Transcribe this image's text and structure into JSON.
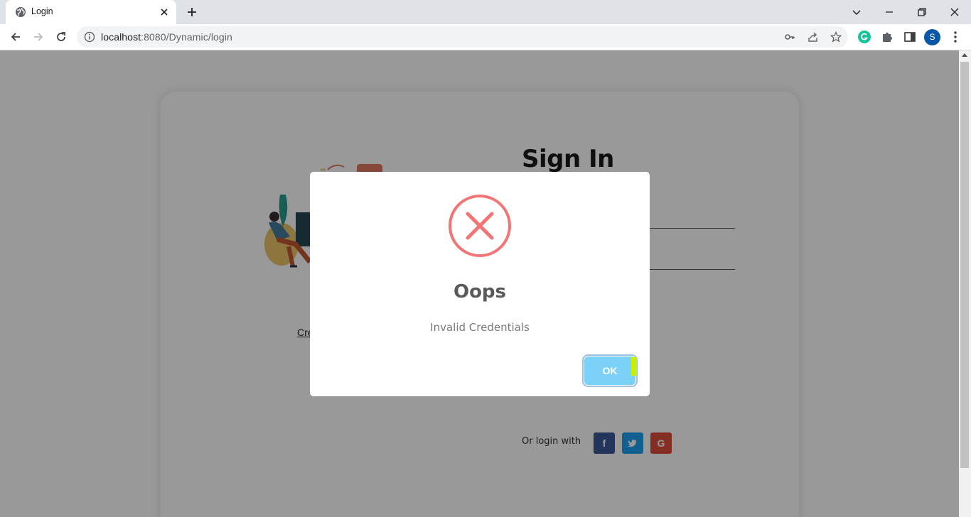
{
  "browser": {
    "tab_title": "Login",
    "url_host": "localhost",
    "url_path": ":8080/Dynamic/login",
    "avatar_letter": "S"
  },
  "page": {
    "signin_title": "Sign In",
    "create_link": "Cre",
    "or_login_with": "Or login with",
    "social": [
      {
        "name": "facebook",
        "glyph": "f",
        "color": "#3b5998"
      },
      {
        "name": "twitter",
        "glyph": "t",
        "color": "#1da1f2"
      },
      {
        "name": "google",
        "glyph": "G",
        "color": "#dd4b39"
      }
    ]
  },
  "modal": {
    "icon": "error-x-icon",
    "title": "Oops",
    "text": "Invalid Credentials",
    "ok_label": "OK",
    "error_color": "#f27474",
    "button_color": "#7cd1f9"
  }
}
